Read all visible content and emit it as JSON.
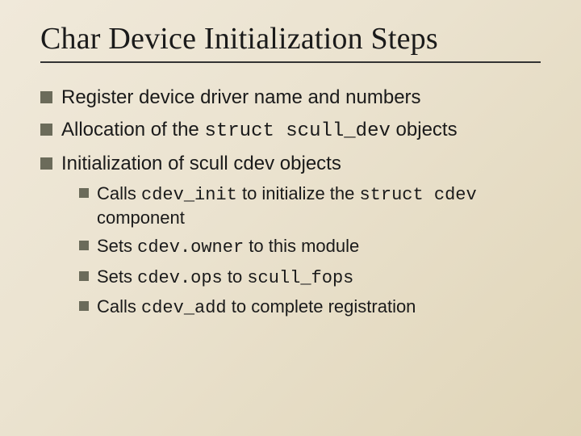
{
  "title": "Char Device Initialization Steps",
  "bullets": {
    "b0": "Register device driver name and numbers",
    "b1_pre": "Allocation of the ",
    "b1_code": "struct scull_dev",
    "b1_post": " objects",
    "b2": "Initialization of scull cdev objects",
    "sub": {
      "s0_pre": "Calls ",
      "s0_code1": "cdev_init",
      "s0_mid": " to initialize the ",
      "s0_code2": "struct cdev",
      "s0_post": " component",
      "s1_pre": "Sets ",
      "s1_code": "cdev.owner",
      "s1_post": " to this module",
      "s2_pre": "Sets ",
      "s2_code1": "cdev.ops",
      "s2_mid": " to ",
      "s2_code2": "scull_fops",
      "s3_pre": "Calls ",
      "s3_code": "cdev_add",
      "s3_post": " to complete registration"
    }
  }
}
